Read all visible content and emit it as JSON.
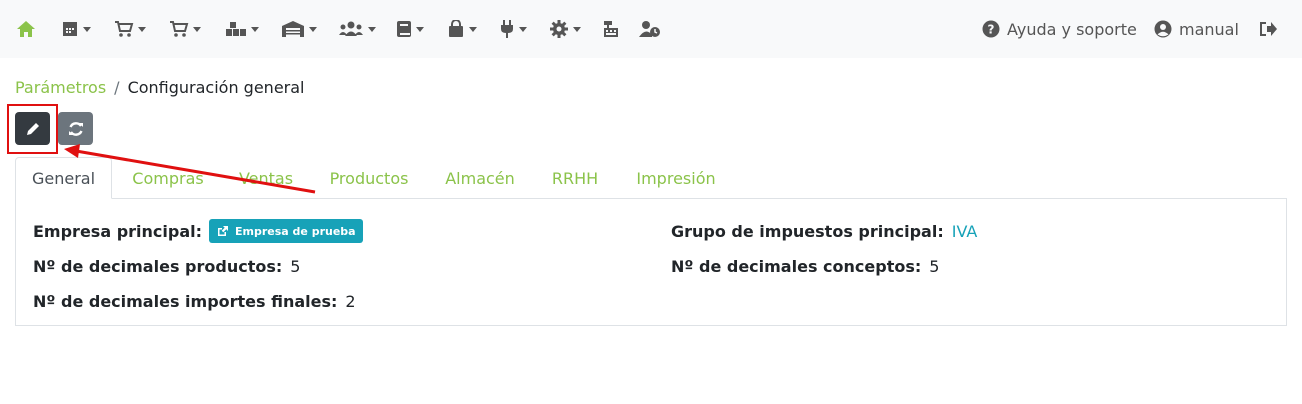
{
  "nav": {
    "icons": [
      "home-icon",
      "calendar-icon",
      "cart-icon",
      "cart-plus-icon",
      "warehouse-boxes-icon",
      "garage-icon",
      "users-icon",
      "book-icon",
      "bag-icon",
      "plug-icon",
      "gear-icon",
      "cash-register-icon",
      "user-clock-icon"
    ],
    "help_label": "Ayuda y soporte",
    "user_label": "manual"
  },
  "breadcrumb": {
    "parent": "Parámetros",
    "separator": "/",
    "current": "Configuración general"
  },
  "tabs": [
    "General",
    "Compras",
    "Ventas",
    "Productos",
    "Almacén",
    "RRHH",
    "Impresión"
  ],
  "active_tab": "General",
  "fields": {
    "empresa_label": "Empresa principal:",
    "empresa_value": "Empresa de prueba",
    "grupo_label": "Grupo de impuestos principal:",
    "grupo_value": "IVA",
    "dec_productos_label": "Nº de decimales productos:",
    "dec_productos_value": "5",
    "dec_conceptos_label": "Nº de decimales conceptos:",
    "dec_conceptos_value": "5",
    "dec_importes_label": "Nº de decimales importes finales:",
    "dec_importes_value": "2"
  },
  "colors": {
    "accent_green": "#8bc34a",
    "teal": "#17a2b8",
    "annotation_red": "#e01010"
  }
}
